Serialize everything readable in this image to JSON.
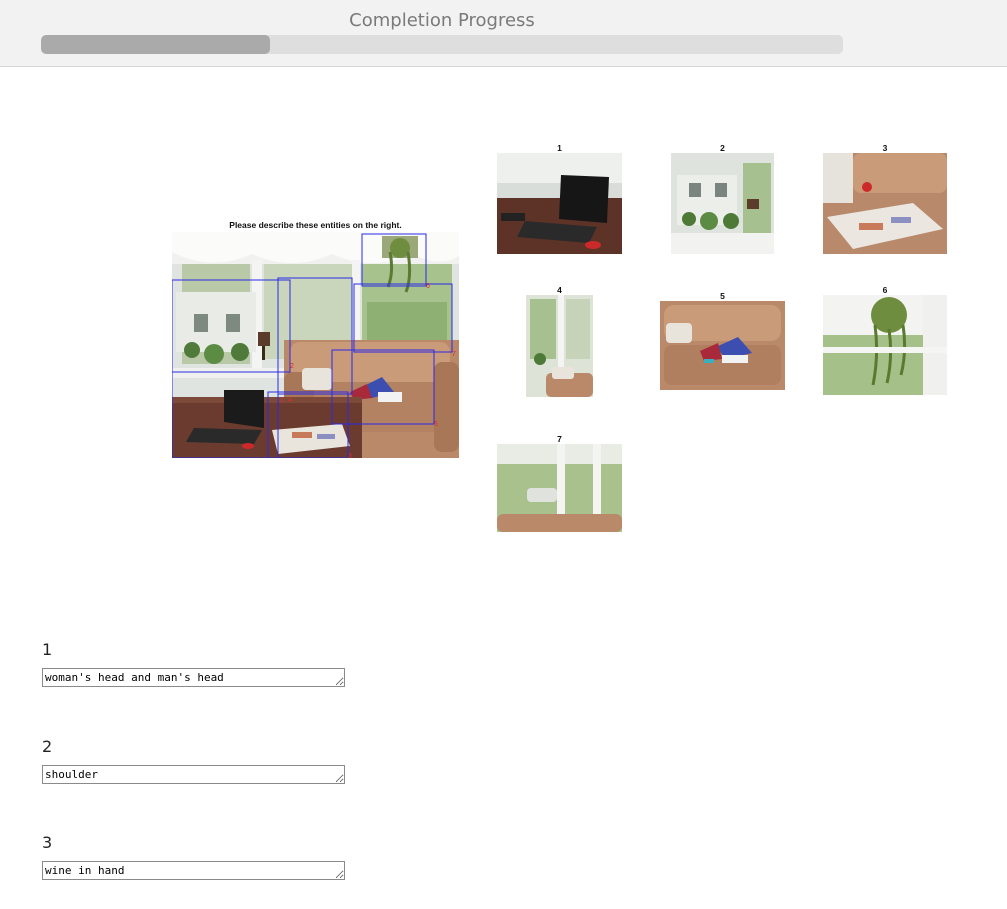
{
  "header": {
    "title": "Completion Progress",
    "progress_fraction": 0.285
  },
  "main_image": {
    "caption": "Please describe these entities on the right.",
    "box_labels": [
      "1",
      "2",
      "3",
      "4",
      "5",
      "6",
      "7"
    ],
    "box_color": "#2a2ae6",
    "box_label_color": "#e52a2a"
  },
  "thumbnails": [
    {
      "label": "1",
      "subject": "laptop-on-table"
    },
    {
      "label": "2",
      "subject": "window-sill-plants"
    },
    {
      "label": "3",
      "subject": "newspapers-on-table"
    },
    {
      "label": "4",
      "subject": "window-corner"
    },
    {
      "label": "5",
      "subject": "leather-sofa-with-pillows"
    },
    {
      "label": "6",
      "subject": "hanging-plant"
    },
    {
      "label": "7",
      "subject": "window-and-sofa-back"
    }
  ],
  "questions": [
    {
      "label": "1",
      "value": "woman's head and man's head"
    },
    {
      "label": "2",
      "value": "shoulder"
    },
    {
      "label": "3",
      "value": "wine in hand"
    }
  ]
}
